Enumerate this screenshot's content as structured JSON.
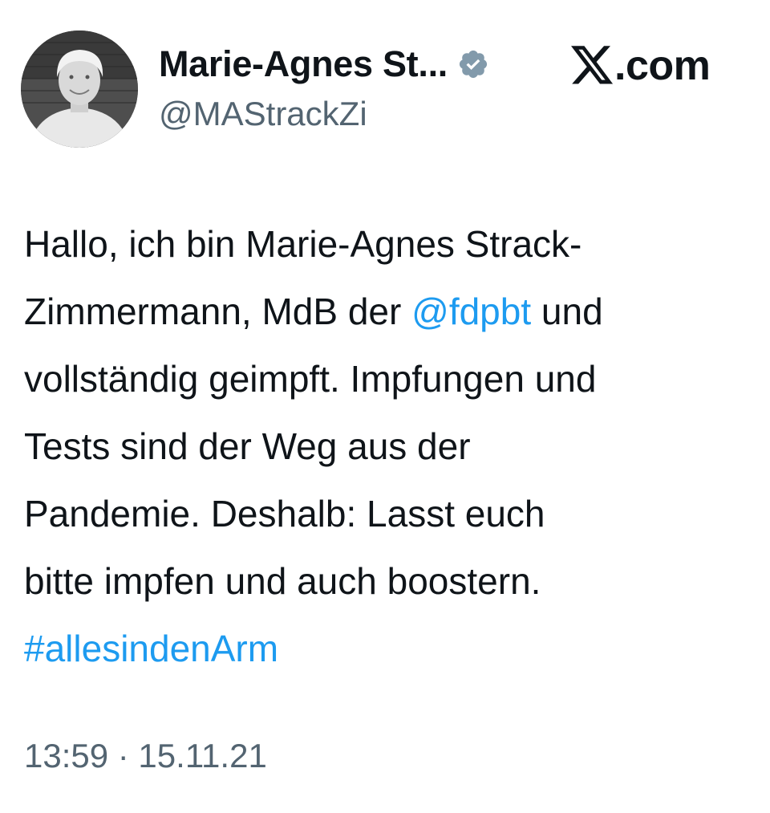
{
  "author": {
    "display_name": "Marie-Agnes St...",
    "handle": "@MAStrackZi",
    "verified_icon": "verified-badge-icon",
    "avatar_icon": "profile-photo"
  },
  "brand": {
    "logo_icon": "x-logo-icon",
    "domain_text": ".com"
  },
  "tweet": {
    "lines": {
      "l1": "Hallo, ich bin Marie-Agnes Strack-",
      "l2_a": "Zimmermann, MdB der ",
      "l2_mention": "@fdpbt",
      "l2_b": " und",
      "l3": "vollständig geimpft. Impfungen und",
      "l4": "Tests sind der Weg aus der",
      "l5": "Pandemie. Deshalb: Lasst euch",
      "l6": "bitte impfen und auch boostern.",
      "l7_hashtag": "#allesindenArm"
    }
  },
  "meta": {
    "timestamp": "13:59 · 15.11.21"
  },
  "colors": {
    "text": "#0f1419",
    "secondary": "#536471",
    "link": "#1d9bf0",
    "verified": "#829aab"
  }
}
